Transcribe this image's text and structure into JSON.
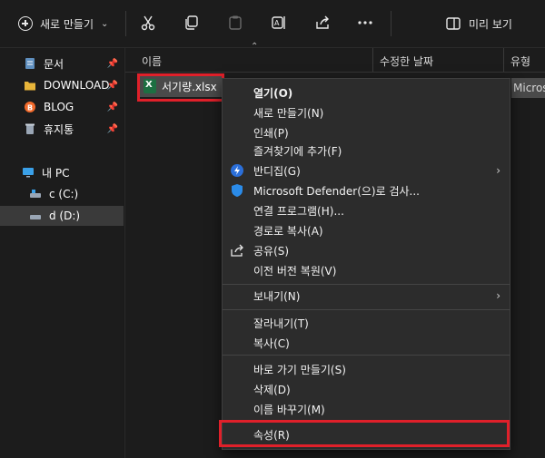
{
  "toolbar": {
    "new_label": "새로 만들기",
    "preview_label": "미리 보기",
    "icons": [
      "cut-icon",
      "copy-icon",
      "paste-icon",
      "rename-icon",
      "share-icon",
      "more-icon"
    ]
  },
  "sidebar": {
    "items": [
      {
        "label": "문서",
        "icon": "document-icon",
        "pinned": true
      },
      {
        "label": "DOWNLOAD",
        "icon": "folder-icon",
        "pinned": true
      },
      {
        "label": "BLOG",
        "icon": "blog-icon",
        "pinned": true
      },
      {
        "label": "휴지통",
        "icon": "recycle-bin-icon",
        "pinned": true
      },
      {
        "label": "내 PC",
        "icon": "pc-icon",
        "pinned": false
      },
      {
        "label": "c (C:)",
        "icon": "drive-icon",
        "pinned": false
      },
      {
        "label": "d (D:)",
        "icon": "drive-icon",
        "pinned": false
      }
    ]
  },
  "columns": {
    "name": "이름",
    "modified": "수정한 날짜",
    "type": "유형"
  },
  "file": {
    "name": "서기량.xlsx",
    "type": "Microsoft"
  },
  "context_menu": {
    "open": "열기(O)",
    "new": "새로 만들기(N)",
    "print": "인쇄(P)",
    "favorites": "즐겨찾기에 추가(F)",
    "bandizip": "반디집(G)",
    "defender": "Microsoft Defender(으)로 검사...",
    "open_with": "연결 프로그램(H)...",
    "copy_path": "경로로 복사(A)",
    "share": "공유(S)",
    "restore": "이전 버전 복원(V)",
    "send_to": "보내기(N)",
    "cut": "잘라내기(T)",
    "copy": "복사(C)",
    "create_shortcut": "바로 가기 만들기(S)",
    "delete": "삭제(D)",
    "rename": "이름 바꾸기(M)",
    "properties": "속성(R)"
  },
  "colors": {
    "highlight": "#e0202a",
    "background": "#191919",
    "menu_bg": "#2c2c2c"
  }
}
